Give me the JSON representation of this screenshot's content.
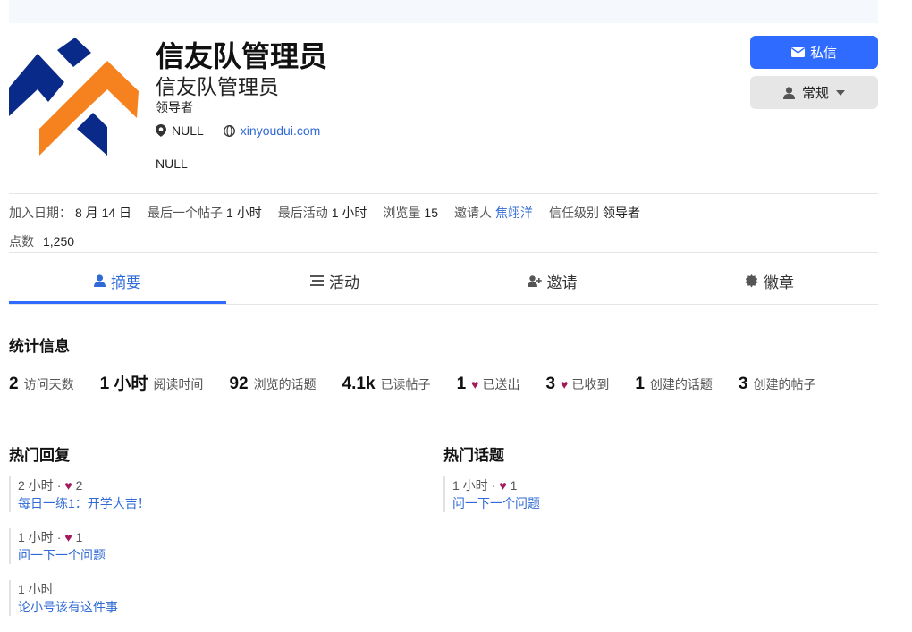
{
  "profile": {
    "name_primary": "信友队管理员",
    "name_secondary": "信友队管理员",
    "title": "领导者",
    "location": "NULL",
    "website": "xinyoudui.com",
    "bio": "NULL"
  },
  "actions": {
    "message_label": "私信",
    "notification_label": "常规"
  },
  "meta": {
    "joined_label": "加入日期：",
    "joined_value": "8 月 14 日",
    "last_post_label": "最后一个帖子",
    "last_post_value": "1 小时",
    "last_active_label": "最后活动",
    "last_active_value": "1 小时",
    "views_label": "浏览量",
    "views_value": "15",
    "invited_by_label": "邀请人",
    "invited_by_value": "焦翊洋",
    "trust_label": "信任级别",
    "trust_value": "领导者",
    "points_label": "点数",
    "points_value": "1,250"
  },
  "tabs": [
    {
      "label": "摘要",
      "icon": "user-icon",
      "active": true
    },
    {
      "label": "活动",
      "icon": "list-icon",
      "active": false
    },
    {
      "label": "邀请",
      "icon": "user-plus-icon",
      "active": false
    },
    {
      "label": "徽章",
      "icon": "certificate-icon",
      "active": false
    }
  ],
  "stats": {
    "title": "统计信息",
    "items": [
      {
        "value": "2",
        "label": "访问天数"
      },
      {
        "value": "1 小时",
        "label": "阅读时间"
      },
      {
        "value": "92",
        "label": "浏览的话题"
      },
      {
        "value": "4.1k",
        "label": "已读帖子"
      },
      {
        "value": "1",
        "label": "已送出"
      },
      {
        "value": "3",
        "label": "已收到"
      },
      {
        "value": "1",
        "label": "创建的话题"
      },
      {
        "value": "3",
        "label": "创建的帖子"
      }
    ]
  },
  "top_replies": {
    "title": "热门回复",
    "items": [
      {
        "time": "2 小时",
        "likes": "2",
        "title": "每日一练1：开学大吉！"
      },
      {
        "time": "1 小时",
        "likes": "1",
        "title": "问一下一个问题"
      },
      {
        "time": "1 小时",
        "likes": "",
        "title": "论小号该有这件事"
      }
    ]
  },
  "top_topics": {
    "title": "热门话题",
    "items": [
      {
        "time": "1 小时",
        "likes": "1",
        "title": "问一下一个问题"
      }
    ]
  },
  "colors": {
    "accent": "#2f6bff",
    "link": "#2f6ad6",
    "heart": "#a3195b",
    "logo_blue": "#0a2a8a",
    "logo_orange": "#f5821f"
  }
}
